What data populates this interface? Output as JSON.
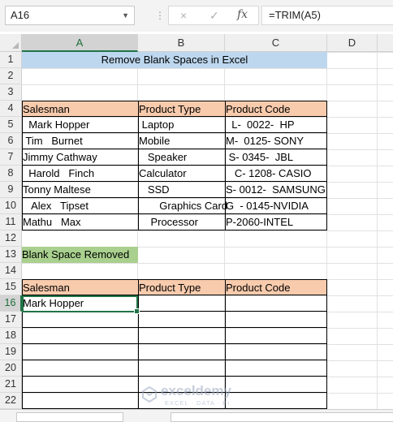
{
  "name_box": "A16",
  "formula_bar": {
    "formula": "=TRIM(A5)",
    "cancel_icon": "×",
    "enter_icon": "✓",
    "fx_label": "fx"
  },
  "columns": [
    "A",
    "B",
    "C",
    "D"
  ],
  "rows": [
    "1",
    "2",
    "3",
    "4",
    "5",
    "6",
    "7",
    "8",
    "9",
    "10",
    "11",
    "12",
    "13",
    "14",
    "15",
    "16",
    "17",
    "18",
    "19",
    "20",
    "21",
    "22"
  ],
  "selected_cell": "A16",
  "title": "Remove Blank Spaces in Excel",
  "table1": {
    "headers": [
      "Salesman",
      "Product Type",
      "Product Code"
    ],
    "rows": [
      [
        "  Mark Hopper",
        " Laptop",
        "  L-  0022-  HP"
      ],
      [
        " Tim   Burnet",
        "Mobile",
        "M-  0125- SONY"
      ],
      [
        "Jimmy Cathway",
        "   Speaker",
        " S- 0345-  JBL"
      ],
      [
        "  Harold   Finch",
        "Calculator",
        "   C- 1208- CASIO"
      ],
      [
        "Tonny Maltese",
        "   SSD",
        "S- 0012-  SAMSUNG"
      ],
      [
        "   Alex   Tipset",
        "       Graphics Card",
        "G  - 0145-NVIDIA"
      ],
      [
        "Mathu   Max",
        "    Processor",
        "P-2060-INTEL"
      ]
    ]
  },
  "section_label": "Blank Space Removed",
  "table2": {
    "headers": [
      "Salesman",
      "Product Type",
      "Product Code"
    ],
    "rows": [
      [
        "Mark Hopper",
        "",
        ""
      ],
      [
        "",
        "",
        ""
      ],
      [
        "",
        "",
        ""
      ],
      [
        "",
        "",
        ""
      ],
      [
        "",
        "",
        ""
      ],
      [
        "",
        "",
        ""
      ],
      [
        "",
        "",
        ""
      ]
    ]
  },
  "watermark": {
    "name": "exceldemy",
    "tagline": "EXCEL · DATA · BI"
  },
  "colors": {
    "title_fill": "#bdd7ee",
    "header_fill": "#f8cbad",
    "section_fill": "#a9d08e",
    "selection": "#217346"
  }
}
